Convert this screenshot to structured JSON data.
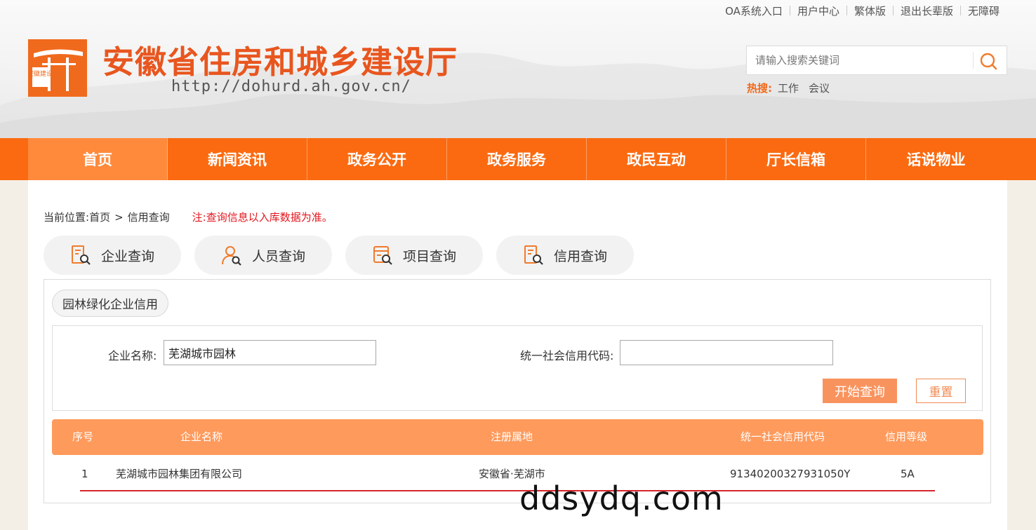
{
  "top_links": [
    "OA系统入口",
    "用户中心",
    "繁体版",
    "退出长辈版",
    "无障碍"
  ],
  "site": {
    "title": "安徽省住房和城乡建设厅",
    "url": "http://dohurd.ah.gov.cn/",
    "logo_text": "安徽建设"
  },
  "search": {
    "placeholder": "请输入搜索关键词",
    "hot_label": "热搜:",
    "hot_items": [
      "工作",
      "会议"
    ]
  },
  "nav": {
    "items": [
      "首页",
      "新闻资讯",
      "政务公开",
      "政务服务",
      "政民互动",
      "厅长信箱",
      "话说物业"
    ],
    "active_index": 0
  },
  "breadcrumb": {
    "prefix": "当前位置:",
    "home": "首页",
    "separator": ">",
    "current": "信用查询",
    "note": "注:查询信息以入库数据为准。"
  },
  "query_tabs": [
    {
      "label": "企业查询",
      "icon": "document-search-icon"
    },
    {
      "label": "人员查询",
      "icon": "person-search-icon"
    },
    {
      "label": "项目查询",
      "icon": "project-search-icon"
    },
    {
      "label": "信用查询",
      "icon": "credit-search-icon"
    }
  ],
  "sub_tab": "园林绿化企业信用",
  "form": {
    "company_label": "企业名称:",
    "company_value": "芜湖城市园林",
    "credit_code_label": "统一社会信用代码:",
    "credit_code_value": "",
    "search_button": "开始查询",
    "reset_button": "重置"
  },
  "table": {
    "headers": [
      "序号",
      "企业名称",
      "注册属地",
      "统一社会信用代码",
      "信用等级"
    ],
    "rows": [
      [
        "1",
        "芜湖城市园林集团有限公司",
        "安徽省·芜湖市",
        "91340200327931050Y",
        "5A"
      ]
    ]
  },
  "watermark": "ddsydq.com",
  "colors": {
    "nav_orange": "#fb6a10",
    "nav_active": "#ff8a3c",
    "title_orange": "#e8561f",
    "table_header": "#fe9a5c",
    "search_button": "#f9935e",
    "note_red": "#e3141b",
    "row_underline": "#d6242c"
  }
}
